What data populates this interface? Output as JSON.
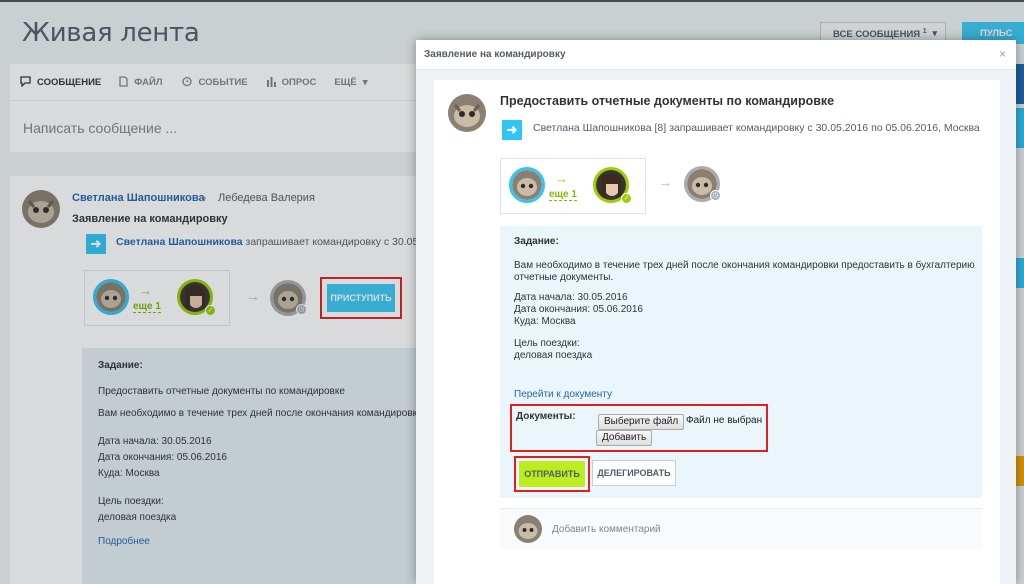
{
  "page": {
    "title": "Живая лента",
    "all_messages_label": "ВСЕ СООБЩЕНИЯ",
    "all_messages_count": "1",
    "pulse_label": "ПУЛЬС КОМ"
  },
  "composer": {
    "tabs": [
      {
        "label": "СООБЩЕНИЕ",
        "icon": "message-icon"
      },
      {
        "label": "ФАЙЛ",
        "icon": "file-icon"
      },
      {
        "label": "СОБЫТИЕ",
        "icon": "alarm-icon"
      },
      {
        "label": "ОПРОС",
        "icon": "poll-icon"
      },
      {
        "label": "ЕЩЁ",
        "icon": "chevron-down-icon"
      }
    ],
    "placeholder": "Написать сообщение ..."
  },
  "post": {
    "author": "Светлана Шапошникова",
    "recipient": "Лебедева Валерия",
    "title": "Заявление на командировку",
    "request_author": "Светлана Шапошникова",
    "request_text": "запрашивает командировку с 30.05",
    "more_label": "еще 1",
    "start_button": "ПРИСТУПИТЬ",
    "task_label": "Задание:",
    "task_title": "Предоставить отчетные документы по командировке",
    "task_desc": "Вам необходимо в течение трех дней после окончания командировки п",
    "start_date": "Дата начала: 30.05.2016",
    "end_date": "Дата окончания: 05.06.2016",
    "destination": "Куда: Москва",
    "purpose_label": "Цель поездки:",
    "purpose": "деловая поездка",
    "details_link": "Подробнее"
  },
  "modal": {
    "title": "Заявление на командировку",
    "close": "×",
    "heading": "Предоставить отчетные документы по командировке",
    "request_line": "Светлана Шапошникова [8] запрашивает командировку с 30.05.2016 по 05.06.2016, Москва",
    "more_label": "еще 1",
    "task_label": "Задание:",
    "task_desc_line1": "Вам необходимо в течение трех дней после окончания командировки предоставить в бухгалтерию",
    "task_desc_line2": "отчетные документы.",
    "start_date": "Дата начала: 30.05.2016",
    "end_date": "Дата окончания: 05.06.2016",
    "destination": "Куда: Москва",
    "purpose_label": "Цель поездки:",
    "purpose": "деловая поездка",
    "goto_link": "Перейти к документу",
    "documents_label": "Документы:",
    "choose_file": "Выберите файл",
    "no_file": "Файл не выбран",
    "add_button": "Добавить",
    "send_button": "ОТПРАВИТЬ",
    "delegate_button": "ДЕЛЕГИРОВАТЬ",
    "comment_placeholder": "Добавить комментарий"
  },
  "colors": {
    "accent_blue": "#2fc6f6",
    "link_blue": "#2067b0",
    "send_green": "#bbed21",
    "highlight_red": "#e02020"
  }
}
